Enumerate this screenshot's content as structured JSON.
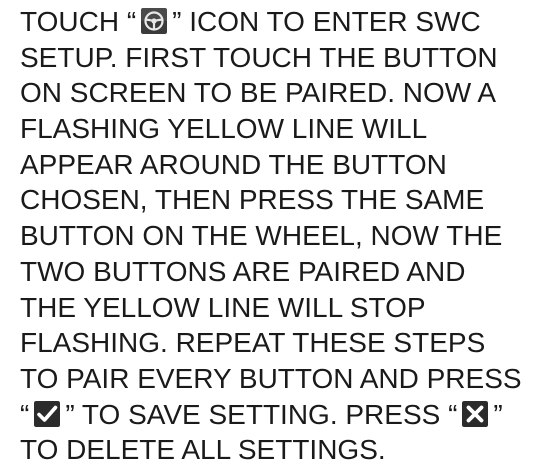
{
  "document": {
    "lines": [
      {
        "before": "TOUCH “",
        "icon": "steering-wheel-icon",
        "after": "” ICON TO ENTER SWC"
      },
      {
        "text": "SETUP. FIRST TOUCH THE BUTTON"
      },
      {
        "text": "ON SCREEN TO BE PAIRED. NOW A"
      },
      {
        "text": "FLASHING YELLOW LINE WILL"
      },
      {
        "text": "APPEAR AROUND THE BUTTON"
      },
      {
        "text": "CHOSEN, THEN PRESS THE SAME"
      },
      {
        "text": "BUTTON ON THE WHEEL, NOW THE"
      },
      {
        "text": "TWO BUTTONS ARE PAIRED AND"
      },
      {
        "text": "THE YELLOW LINE WILL STOP"
      },
      {
        "text": "FLASHING. REPEAT THESE STEPS"
      },
      {
        "text": "TO PAIR EVERY BUTTON AND PRESS"
      },
      {
        "before": "“",
        "icon": "check-icon",
        "after": "” TO SAVE SETTING. PRESS “",
        "icon2": "close-icon",
        "after2": "”"
      },
      {
        "text": "TO DELETE ALL SETTINGS."
      }
    ]
  },
  "colors": {
    "text": "#1a1a1a",
    "icon_background": "#2b2b2b",
    "icon_foreground": "#ffffff"
  }
}
